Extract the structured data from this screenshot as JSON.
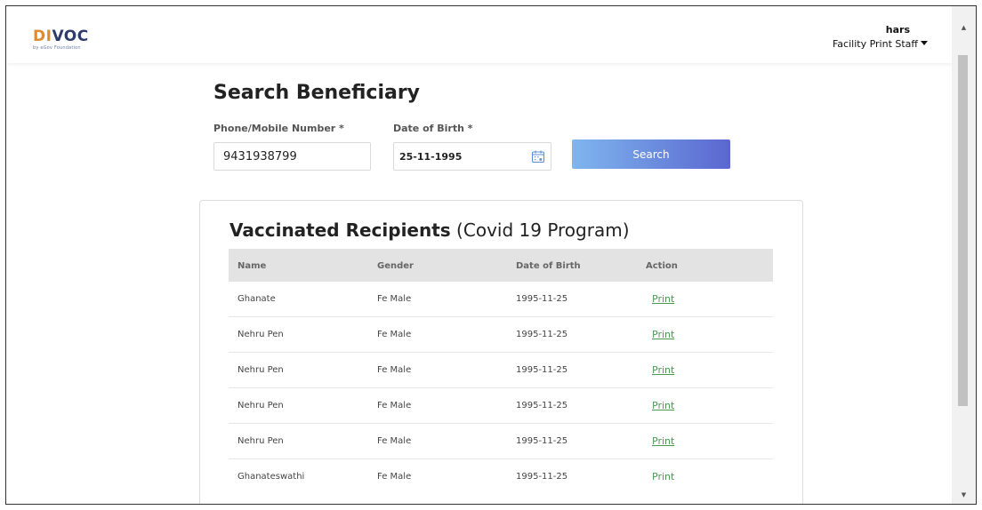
{
  "header": {
    "logo_prefix": "DI",
    "logo_suffix": "VOC",
    "logo_tagline": "by eGov Foundation",
    "user_name": "hars",
    "user_role": "Facility Print Staff"
  },
  "search": {
    "title": "Search Beneficiary",
    "phone_label": "Phone/Mobile Number *",
    "phone_value": "9431938799",
    "dob_label": "Date of Birth *",
    "dob_value": "25-11-1995",
    "button_label": "Search"
  },
  "results": {
    "title_bold": "Vaccinated Recipients",
    "title_rest": " (Covid 19 Program)",
    "columns": [
      "Name",
      "Gender",
      "Date of Birth",
      "Action"
    ],
    "rows": [
      {
        "name": "Ghanate",
        "gender": "Fe Male",
        "dob": "1995-11-25",
        "action": "Print"
      },
      {
        "name": "Nehru Pen",
        "gender": "Fe Male",
        "dob": "1995-11-25",
        "action": "Print"
      },
      {
        "name": "Nehru Pen",
        "gender": "Fe Male",
        "dob": "1995-11-25",
        "action": "Print"
      },
      {
        "name": "Nehru Pen",
        "gender": "Fe Male",
        "dob": "1995-11-25",
        "action": "Print"
      },
      {
        "name": "Nehru Pen",
        "gender": "Fe Male",
        "dob": "1995-11-25",
        "action": "Print"
      },
      {
        "name": "Ghanateswathi",
        "gender": "Fe Male",
        "dob": "1995-11-25",
        "action": "Print"
      }
    ]
  },
  "colors": {
    "accent_link": "#4a9c4f",
    "button_start": "#7fb6ee",
    "button_end": "#5a67d0",
    "logo_orange": "#e48a2e",
    "logo_navy": "#2e3c6b"
  },
  "icons": {
    "calendar": "calendar-icon",
    "dropdown": "caret-down-icon"
  }
}
